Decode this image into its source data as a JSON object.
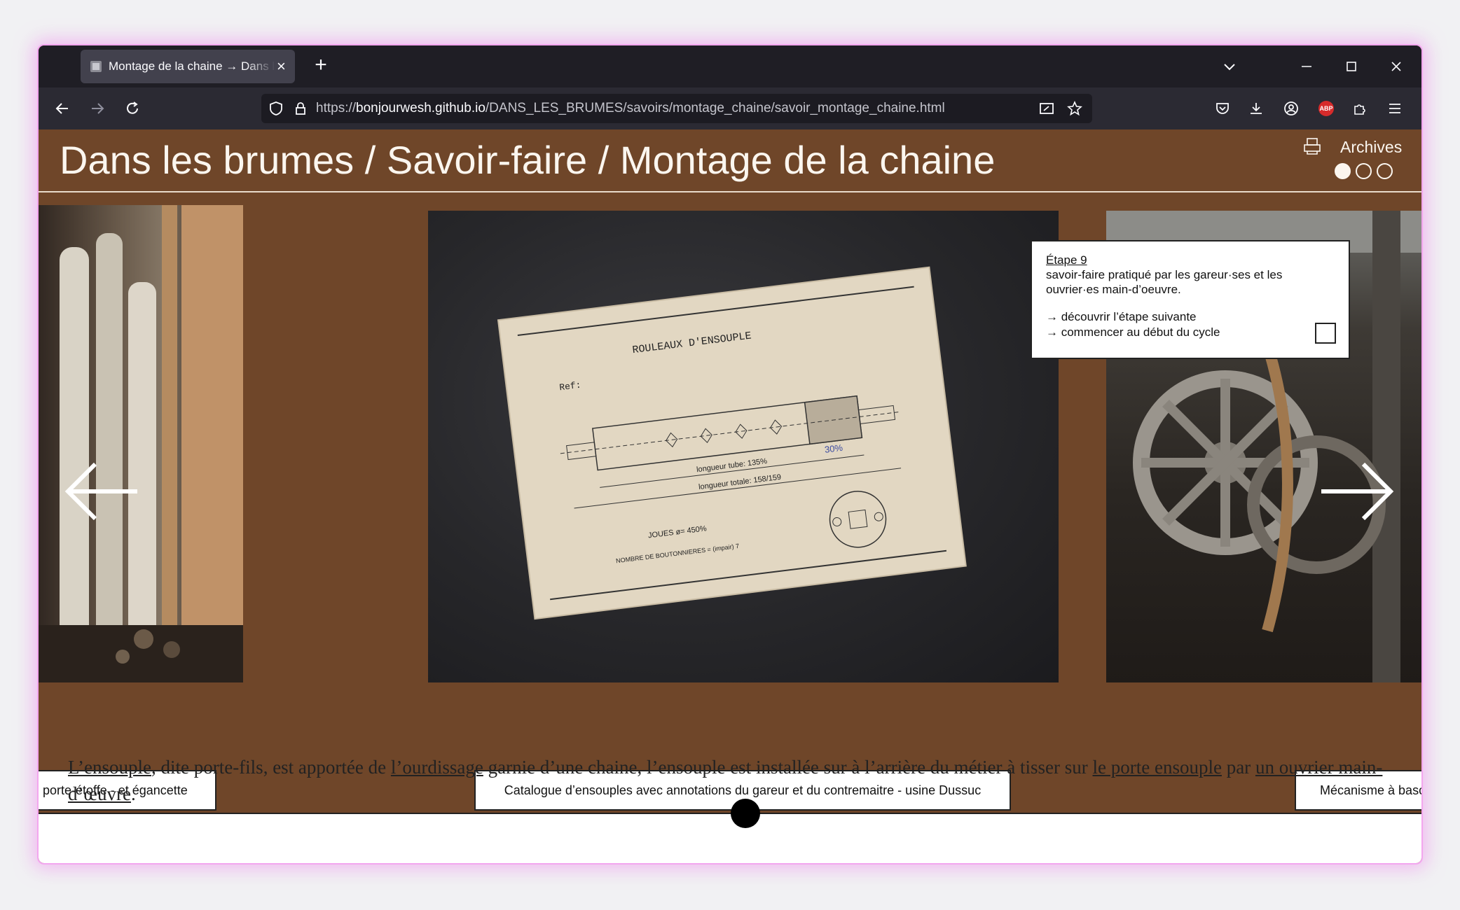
{
  "browser": {
    "tab_title": "Montage de la chaine → Dans les brumes",
    "url_prefix": "https://",
    "url_host": "bonjourwesh.github.io",
    "url_path": "/DANS_LES_BRUMES/savoirs/montage_chaine/savoir_montage_chaine.html"
  },
  "header": {
    "title": "Dans les brumes / Savoir-faire / Montage de la chaine",
    "archives_label": "Archives",
    "dots": [
      true,
      false,
      false
    ]
  },
  "info": {
    "step": "Étape 9",
    "description": "savoir-faire pratiqué par les gareur·ses et les ouvrier·es main-d’oeuvre.",
    "next_link": "→ découvrir l’étape suivante",
    "restart_link": "→ commencer au début du cycle"
  },
  "captions": {
    "left": "porte-étoffe - et égancette",
    "center": "Catalogue d’ensouples avec annotations du gareur et du contremaitre - usine Dussuc",
    "right": "Mécanisme à bascule"
  },
  "drawing": {
    "title": "ROULEAUX D'ENSOUPLE",
    "ref": "Ref:",
    "longueur_tube": "longueur tube: 135%",
    "longueur_totale": "longueur totale: 158/159",
    "joues": "JOUES ø= 450%",
    "boutonnieres": "NOMBRE DE BOUTONNIERES = (impair) 7",
    "pct_30": "30%"
  },
  "body": {
    "l_ensouple": "L’ensouple",
    "part1": ", dite porte-fils, est apportée de ",
    "l_ourdissage": "l’ourdissage",
    "part2": " garnie d’une chaine, l’ensouple est installée sur à l’arrière du métier à tisser sur ",
    "le_porte_ensouple": "le porte ensouple",
    "part3": " par ",
    "un_ouvrier": "un ouvrier main-d’œuvre",
    "part4": "."
  }
}
